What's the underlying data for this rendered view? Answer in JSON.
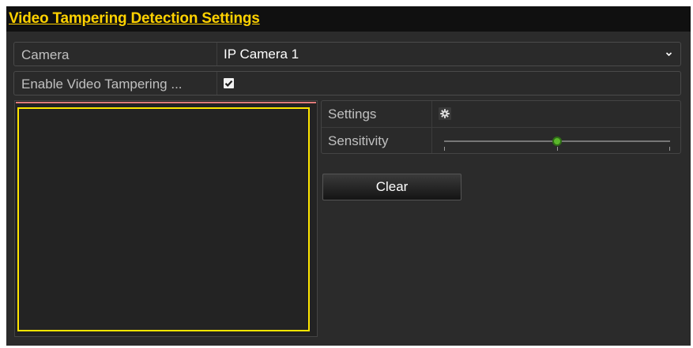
{
  "page": {
    "title": "Video Tampering Detection Settings"
  },
  "form": {
    "camera": {
      "label": "Camera",
      "value": "IP Camera 1",
      "icon": "chevron-down-icon"
    },
    "enable": {
      "label": "Enable Video Tampering ...",
      "checked": true,
      "icon": "checkmark-icon"
    }
  },
  "params": {
    "settings_label": "Settings",
    "settings_icon": "gear-icon",
    "sensitivity_label": "Sensitivity",
    "sensitivity_level": 0.5
  },
  "actions": {
    "clear_label": "Clear"
  },
  "colors": {
    "title": "#ffd200",
    "detection_area_border": "#ffe600",
    "slider_knob": "#5bb82b",
    "background": "#2b2b2b"
  }
}
